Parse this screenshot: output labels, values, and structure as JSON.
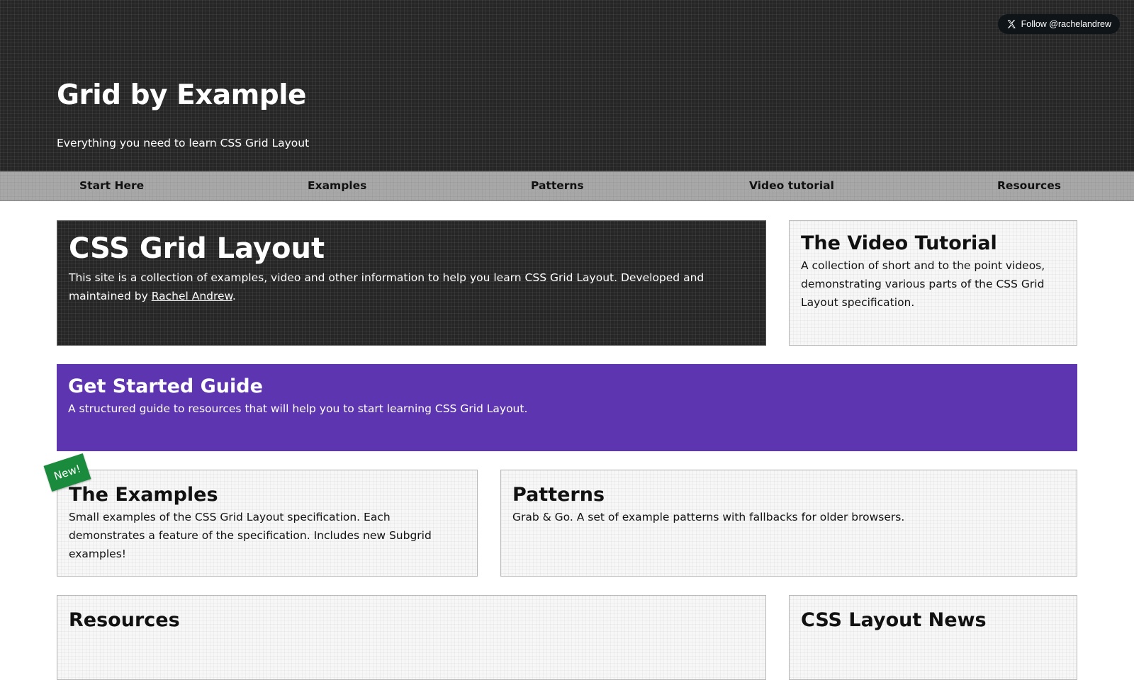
{
  "header": {
    "title": "Grid by Example",
    "tagline": "Everything you need to learn CSS Grid Layout",
    "follow_button": {
      "label": "Follow @rachelandrew",
      "icon": "x-logo-icon"
    }
  },
  "nav": {
    "items": [
      {
        "label": "Start Here"
      },
      {
        "label": "Examples"
      },
      {
        "label": "Patterns"
      },
      {
        "label": "Video tutorial"
      },
      {
        "label": "Resources"
      }
    ]
  },
  "hero": {
    "title": "CSS Grid Layout",
    "text_before_link": "This site is a collection of examples, video and other information to help you learn CSS Grid Layout. Developed and maintained by ",
    "link_text": "Rachel Andrew",
    "text_after_link": "."
  },
  "video_tutorial": {
    "title": "The Video Tutorial",
    "text": "A collection of short and to the point videos, demonstrating various parts of the CSS Grid Layout specification."
  },
  "get_started": {
    "title": "Get Started Guide",
    "text": "A structured guide to resources that will help you to start learning CSS Grid Layout.",
    "color": "#5e35b1"
  },
  "examples": {
    "badge": "New!",
    "badge_color": "#1a8a3c",
    "title": "The Examples",
    "text": "Small examples of the CSS Grid Layout specification. Each demonstrates a feature of the specification. Includes new Subgrid examples!"
  },
  "patterns": {
    "title": "Patterns",
    "text": "Grab & Go. A set of example patterns with fallbacks for older browsers."
  },
  "resources": {
    "title": "Resources"
  },
  "news": {
    "title": "CSS Layout News"
  }
}
